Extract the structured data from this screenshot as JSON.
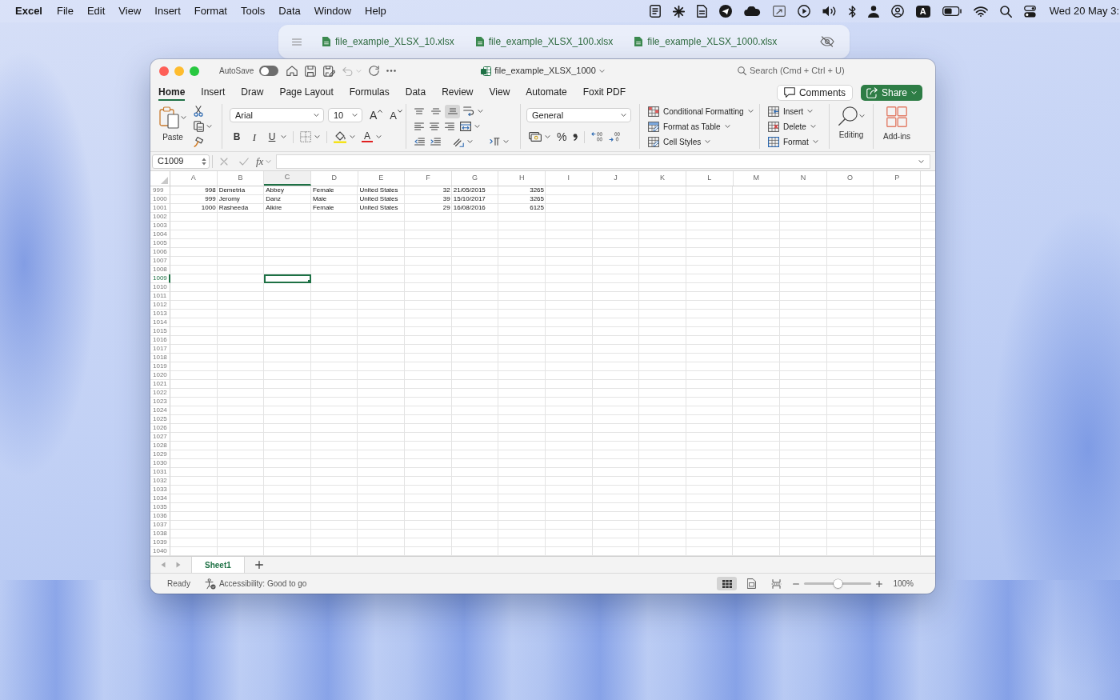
{
  "menu_bar": {
    "app_name": "Excel",
    "menus": [
      "File",
      "Edit",
      "View",
      "Insert",
      "Format",
      "Tools",
      "Data",
      "Window",
      "Help"
    ],
    "input_source": "A",
    "clock": "Wed 20 May 3:"
  },
  "file_tabs": [
    "file_example_XLSX_10.xlsx",
    "file_example_XLSX_100.xlsx",
    "file_example_XLSX_1000.xlsx"
  ],
  "window": {
    "title": "file_example_XLSX_1000",
    "autosave": {
      "label": "AutoSave",
      "on": false
    },
    "undo": {
      "disabled": true
    },
    "search": {
      "placeholder": "Search (Cmd + Ctrl + U)"
    }
  },
  "ribbon_tabs": [
    {
      "label": "Home",
      "selected": true
    },
    {
      "label": "Insert",
      "selected": false
    },
    {
      "label": "Draw",
      "selected": false
    },
    {
      "label": "Page Layout",
      "selected": false
    },
    {
      "label": "Formulas",
      "selected": false
    },
    {
      "label": "Data",
      "selected": false
    },
    {
      "label": "Review",
      "selected": false
    },
    {
      "label": "View",
      "selected": false
    },
    {
      "label": "Automate",
      "selected": false
    },
    {
      "label": "Foxit PDF",
      "selected": false
    }
  ],
  "ribbon_actions": {
    "comments": "Comments",
    "share": "Share"
  },
  "ribbon": {
    "paste": "Paste",
    "font": {
      "name": "Arial",
      "size": "10",
      "grow": "A",
      "shrink": "A",
      "bold": "B",
      "italic": "I",
      "underline": "U",
      "font_tint": "A"
    },
    "vertical_align": [
      {
        "kind": "top",
        "selected": false
      },
      {
        "kind": "middle",
        "selected": false
      },
      {
        "kind": "bottom",
        "selected": true
      }
    ],
    "number": {
      "format": "General",
      "percent": "%"
    },
    "styles": [
      "Conditional Formatting",
      "Format as Table",
      "Cell Styles"
    ],
    "cells": [
      "Insert",
      "Delete",
      "Format"
    ],
    "editing": "Editing",
    "add_ins": "Add-ins"
  },
  "formula_bar": {
    "name_box": "C1009",
    "function": "fx"
  },
  "sheet": {
    "columns": [
      {
        "label": "A",
        "selected": false
      },
      {
        "label": "B",
        "selected": false
      },
      {
        "label": "C",
        "selected": true
      },
      {
        "label": "D",
        "selected": false
      },
      {
        "label": "E",
        "selected": false
      },
      {
        "label": "F",
        "selected": false
      },
      {
        "label": "G",
        "selected": false
      },
      {
        "label": "H",
        "selected": false
      },
      {
        "label": "I",
        "selected": false
      },
      {
        "label": "J",
        "selected": false
      },
      {
        "label": "K",
        "selected": false
      },
      {
        "label": "L",
        "selected": false
      },
      {
        "label": "M",
        "selected": false
      },
      {
        "label": "N",
        "selected": false
      },
      {
        "label": "O",
        "selected": false
      },
      {
        "label": "P",
        "selected": false
      }
    ],
    "rows": [
      {
        "number": "999",
        "selected": false,
        "cells": [
          {
            "text": "998",
            "kind": "number"
          },
          {
            "text": "Demetria",
            "kind": "text"
          },
          {
            "text": "Abbey",
            "kind": "text"
          },
          {
            "text": "Female",
            "kind": "text"
          },
          {
            "text": "United States",
            "kind": "text"
          },
          {
            "text": "32",
            "kind": "number"
          },
          {
            "text": "21/05/2015",
            "kind": "text"
          },
          {
            "text": "3265",
            "kind": "number"
          }
        ]
      },
      {
        "number": "1000",
        "selected": false,
        "cells": [
          {
            "text": "999",
            "kind": "number"
          },
          {
            "text": "Jeromy",
            "kind": "text"
          },
          {
            "text": "Danz",
            "kind": "text"
          },
          {
            "text": "Male",
            "kind": "text"
          },
          {
            "text": "United States",
            "kind": "text"
          },
          {
            "text": "39",
            "kind": "number"
          },
          {
            "text": "15/10/2017",
            "kind": "text"
          },
          {
            "text": "3265",
            "kind": "number"
          }
        ]
      },
      {
        "number": "1001",
        "selected": false,
        "cells": [
          {
            "text": "1000",
            "kind": "number"
          },
          {
            "text": "Rasheeda",
            "kind": "text"
          },
          {
            "text": "Alkire",
            "kind": "text"
          },
          {
            "text": "Female",
            "kind": "text"
          },
          {
            "text": "United States",
            "kind": "text"
          },
          {
            "text": "29",
            "kind": "number"
          },
          {
            "text": "16/08/2016",
            "kind": "text"
          },
          {
            "text": "6125",
            "kind": "number"
          }
        ]
      },
      {
        "number": "1002",
        "selected": false
      },
      {
        "number": "1003",
        "selected": false
      },
      {
        "number": "1004",
        "selected": false
      },
      {
        "number": "1005",
        "selected": false
      },
      {
        "number": "1006",
        "selected": false
      },
      {
        "number": "1007",
        "selected": false
      },
      {
        "number": "1008",
        "selected": false
      },
      {
        "number": "1009",
        "selected": true
      },
      {
        "number": "1010",
        "selected": false
      },
      {
        "number": "1011",
        "selected": false
      },
      {
        "number": "1012",
        "selected": false
      },
      {
        "number": "1013",
        "selected": false
      },
      {
        "number": "1014",
        "selected": false
      },
      {
        "number": "1015",
        "selected": false
      },
      {
        "number": "1016",
        "selected": false
      },
      {
        "number": "1017",
        "selected": false
      },
      {
        "number": "1018",
        "selected": false
      },
      {
        "number": "1019",
        "selected": false
      },
      {
        "number": "1020",
        "selected": false
      },
      {
        "number": "1021",
        "selected": false
      },
      {
        "number": "1022",
        "selected": false
      },
      {
        "number": "1023",
        "selected": false
      },
      {
        "number": "1024",
        "selected": false
      },
      {
        "number": "1025",
        "selected": false
      },
      {
        "number": "1026",
        "selected": false
      },
      {
        "number": "1027",
        "selected": false
      },
      {
        "number": "1028",
        "selected": false
      },
      {
        "number": "1029",
        "selected": false
      },
      {
        "number": "1030",
        "selected": false
      },
      {
        "number": "1031",
        "selected": false
      },
      {
        "number": "1032",
        "selected": false
      },
      {
        "number": "1033",
        "selected": false
      },
      {
        "number": "1034",
        "selected": false
      },
      {
        "number": "1035",
        "selected": false
      },
      {
        "number": "1036",
        "selected": false
      },
      {
        "number": "1037",
        "selected": false
      },
      {
        "number": "1038",
        "selected": false
      },
      {
        "number": "1039",
        "selected": false
      },
      {
        "number": "1040",
        "selected": false
      }
    ]
  },
  "sheet_tabs": [
    {
      "label": "Sheet1",
      "selected": true
    }
  ],
  "status_bar": {
    "status": "Ready",
    "accessibility": "Accessibility: Good to go",
    "views": [
      {
        "kind": "normal",
        "selected": true
      },
      {
        "kind": "page_layout",
        "selected": false
      },
      {
        "kind": "page_break",
        "selected": false
      }
    ],
    "zoom": {
      "level": 0.5,
      "reading": "100%"
    }
  }
}
